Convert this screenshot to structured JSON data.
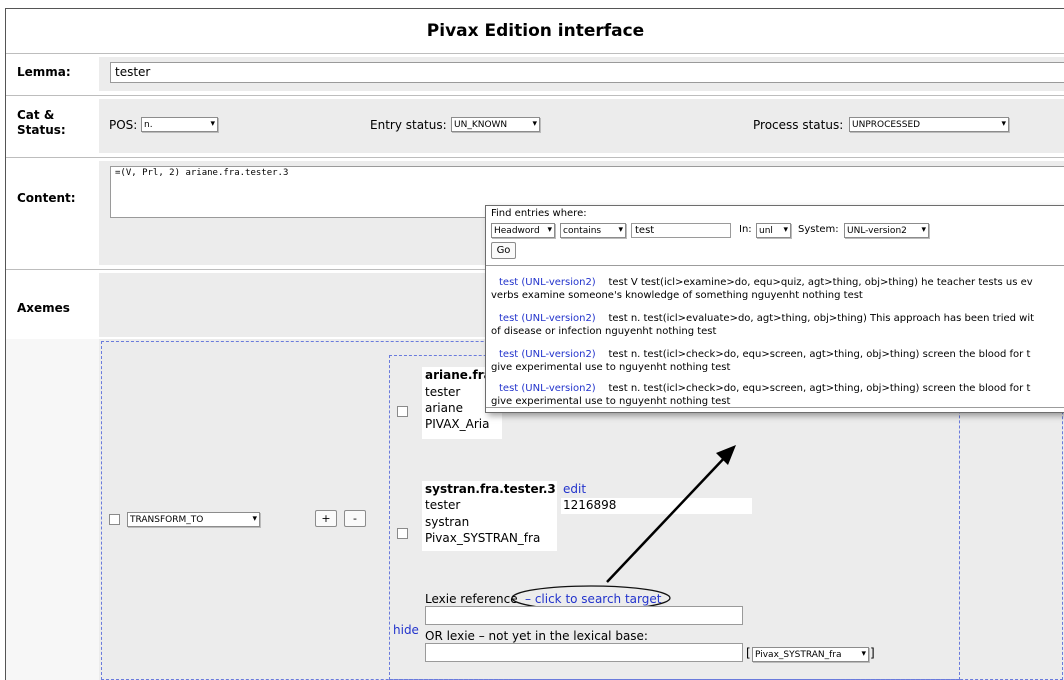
{
  "header": {
    "title": "Pivax Edition interface"
  },
  "lemma": {
    "label": "Lemma:",
    "value": "tester"
  },
  "cat_status": {
    "label_line1": "Cat &",
    "label_line2": "Status:",
    "pos_label": "POS:",
    "pos_value": "n.",
    "entry_status_label": "Entry status:",
    "entry_status_value": "UN_KNOWN",
    "process_status_label": "Process status:",
    "process_status_value": "UNPROCESSED"
  },
  "content": {
    "label": "Content:",
    "value": "=(V, Prl, 2) ariane.fra.tester.3"
  },
  "axemes": {
    "label": "Axemes",
    "relation_value": "TRANSFORM_TO",
    "add_label": "+",
    "remove_label": "-",
    "ariane": {
      "title": "ariane.fra",
      "line1": "tester",
      "line2": "ariane",
      "line3": "PIVAX_Aria"
    },
    "systran": {
      "title": "systran.fra.tester.3",
      "edit_label": "edit",
      "line1": "tester",
      "id": "1216898",
      "line2": "systran",
      "line3": "Pivax_SYSTRAN_fra"
    },
    "lexie_reference_label": "Lexie reference",
    "search_target_link": "– click to search target",
    "hide_label": "hide",
    "or_lexie_label": "OR lexie – not yet in the lexical base:",
    "dictionary_value": "Pivax_SYSTRAN_fra"
  },
  "popup": {
    "find_label": "Find entries where:",
    "field_value": "Headword",
    "operator_value": "contains",
    "query_value": "test",
    "in_label": "In:",
    "in_value": "unl",
    "system_label": "System:",
    "system_value": "UNL-version2",
    "go_label": "Go",
    "results": [
      {
        "head": "test (UNL-version2)",
        "line1": "test V test(icl>examine>do, equ>quiz, agt>thing, obj>thing) he teacher tests us ev",
        "line2": "verbs examine someone's knowledge of something nguyenht nothing test"
      },
      {
        "head": "test (UNL-version2)",
        "line1": "test n. test(icl>evaluate>do, agt>thing, obj>thing) This approach has been tried wit",
        "line2": "of disease or infection nguyenht nothing test"
      },
      {
        "head": "test (UNL-version2)",
        "line1": "test n. test(icl>check>do, equ>screen, agt>thing, obj>thing) screen the blood for t",
        "line2": "give experimental use to nguyenht nothing test"
      },
      {
        "head": "test (UNL-version2)",
        "line1": "test n. test(icl>check>do, equ>screen, agt>thing, obj>thing) screen the blood for t",
        "line2": "give experimental use to nguyenht nothing test"
      }
    ]
  }
}
